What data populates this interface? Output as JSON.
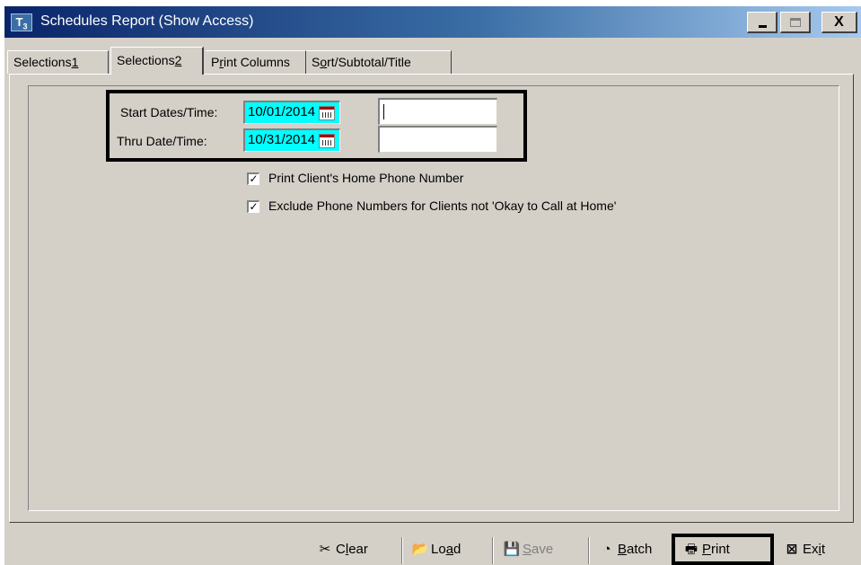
{
  "window": {
    "icon_letter": "T",
    "icon_sub": "3",
    "title": "Schedules Report (Show Access)",
    "close_glyph": "X"
  },
  "tabs": [
    {
      "label": "Selections1",
      "active": false
    },
    {
      "label": "Selections2",
      "active": true
    },
    {
      "label": "Print Columns",
      "active": false
    },
    {
      "label": "Sort/Subtotal/Title",
      "active": false
    }
  ],
  "form": {
    "start_label": "Start Dates/Time:",
    "start_date": "10/01/2014",
    "start_time": "",
    "thru_label": "Thru Date/Time:",
    "thru_date": "10/31/2014",
    "thru_time": "",
    "checkboxes": [
      {
        "label": "Print Client's Home Phone Number",
        "checked": true
      },
      {
        "label": "Exclude Phone Numbers for Clients not 'Okay to Call at Home'",
        "checked": true
      }
    ]
  },
  "toolbar": {
    "clear": "Clear",
    "load": "Load",
    "save": "Save",
    "batch": "Batch",
    "print": "Print",
    "exit": "Exit"
  },
  "colors": {
    "date_field_bg": "#00ffff",
    "title_bar_start": "#0a246a",
    "title_bar_end": "#a6caf0",
    "window_bg": "#d4d0c8"
  }
}
